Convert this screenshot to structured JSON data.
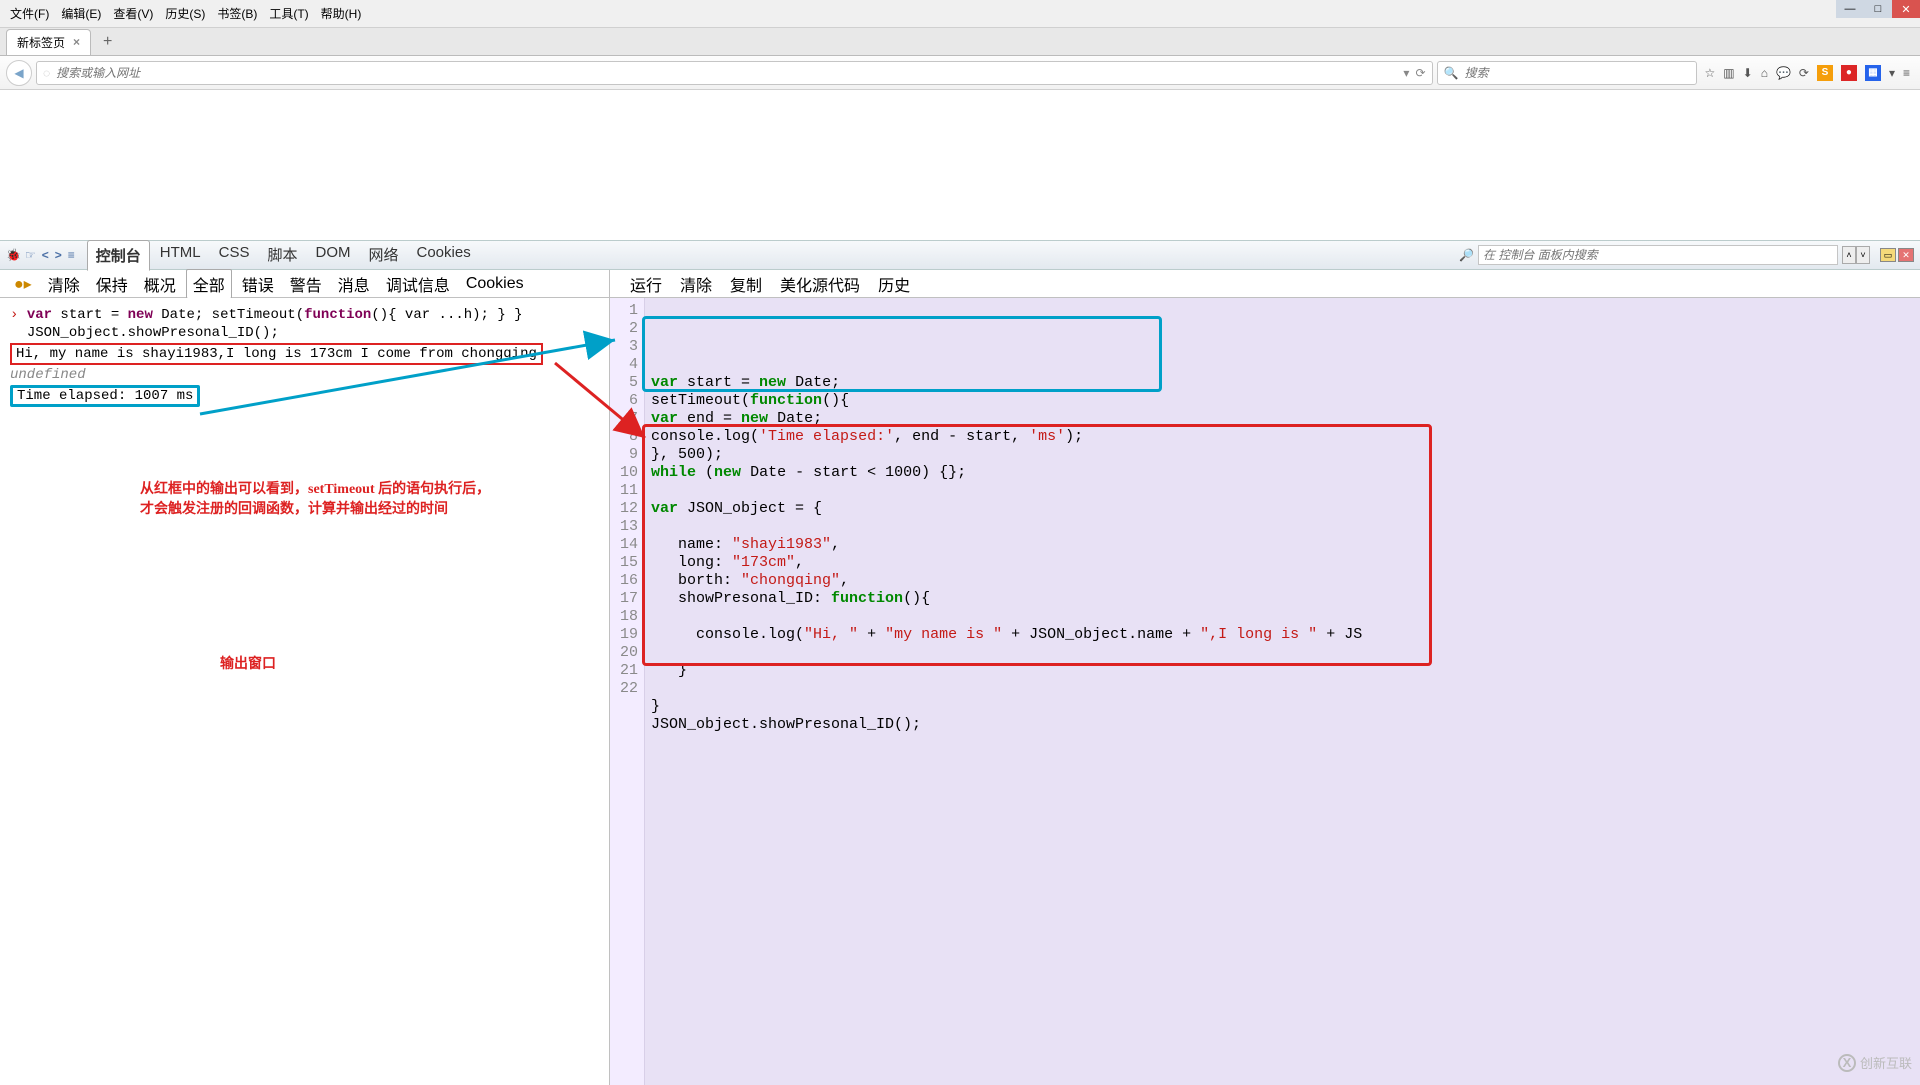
{
  "menu": {
    "items": [
      "文件(F)",
      "编辑(E)",
      "查看(V)",
      "历史(S)",
      "书签(B)",
      "工具(T)",
      "帮助(H)"
    ]
  },
  "tab": {
    "title": "新标签页"
  },
  "url": {
    "placeholder": "搜索或输入网址"
  },
  "search": {
    "placeholder": "搜索"
  },
  "firebug": {
    "tabs": [
      "控制台",
      "HTML",
      "CSS",
      "脚本",
      "DOM",
      "网络",
      "Cookies"
    ],
    "active_tab": "控制台",
    "search_placeholder": "在 控制台 面板内搜索",
    "left_sub": [
      "清除",
      "保持",
      "概况",
      "全部",
      "错误",
      "警告",
      "消息",
      "调试信息",
      "Cookies"
    ],
    "left_sub_pill": "全部",
    "right_sub": [
      "运行",
      "清除",
      "复制",
      "美化源代码",
      "历史"
    ]
  },
  "console": {
    "line1_a": "var",
    "line1_b": " start = ",
    "line1_c": "new",
    "line1_d": " Date; setTimeout(",
    "line1_e": "function",
    "line1_f": "(){ var ...h);      }     }",
    "line2": "JSON_object.showPresonal_ID();",
    "line3": "Hi, my name is shayi1983,I long is 173cm I come from chongqing",
    "line4": "undefined",
    "line5": "Time elapsed: 1007 ms"
  },
  "code": {
    "lines": [
      {
        "n": 1,
        "t": [
          {
            "c": "kw",
            "v": "var"
          },
          {
            "c": "",
            "v": " start = "
          },
          {
            "c": "kw",
            "v": "new"
          },
          {
            "c": "",
            "v": " Date;"
          }
        ]
      },
      {
        "n": 2,
        "t": [
          {
            "c": "",
            "v": "setTimeout("
          },
          {
            "c": "kw",
            "v": "function"
          },
          {
            "c": "",
            "v": "(){"
          }
        ]
      },
      {
        "n": 3,
        "t": [
          {
            "c": "kw",
            "v": "var"
          },
          {
            "c": "",
            "v": " end = "
          },
          {
            "c": "kw",
            "v": "new"
          },
          {
            "c": "",
            "v": " Date;"
          }
        ]
      },
      {
        "n": 4,
        "t": [
          {
            "c": "",
            "v": "console.log("
          },
          {
            "c": "str",
            "v": "'Time elapsed:'"
          },
          {
            "c": "",
            "v": ", end - start, "
          },
          {
            "c": "str",
            "v": "'ms'"
          },
          {
            "c": "",
            "v": ");"
          }
        ]
      },
      {
        "n": 5,
        "t": [
          {
            "c": "",
            "v": "}, 500);"
          }
        ]
      },
      {
        "n": 6,
        "t": [
          {
            "c": "kw",
            "v": "while"
          },
          {
            "c": "",
            "v": " ("
          },
          {
            "c": "kw",
            "v": "new"
          },
          {
            "c": "",
            "v": " Date - start < 1000) {};"
          }
        ]
      },
      {
        "n": 7,
        "t": [
          {
            "c": "",
            "v": ""
          }
        ]
      },
      {
        "n": 8,
        "t": [
          {
            "c": "kw",
            "v": "var"
          },
          {
            "c": "",
            "v": " JSON_object = {"
          }
        ]
      },
      {
        "n": 9,
        "t": [
          {
            "c": "",
            "v": ""
          }
        ]
      },
      {
        "n": 10,
        "t": [
          {
            "c": "",
            "v": "   name: "
          },
          {
            "c": "str",
            "v": "\"shayi1983\""
          },
          {
            "c": "",
            "v": ","
          }
        ]
      },
      {
        "n": 11,
        "t": [
          {
            "c": "",
            "v": "   long: "
          },
          {
            "c": "str",
            "v": "\"173cm\""
          },
          {
            "c": "",
            "v": ","
          }
        ]
      },
      {
        "n": 12,
        "t": [
          {
            "c": "",
            "v": "   borth: "
          },
          {
            "c": "str",
            "v": "\"chongqing\""
          },
          {
            "c": "",
            "v": ","
          }
        ]
      },
      {
        "n": 13,
        "t": [
          {
            "c": "",
            "v": "   showPresonal_ID: "
          },
          {
            "c": "kw",
            "v": "function"
          },
          {
            "c": "",
            "v": "(){"
          }
        ]
      },
      {
        "n": 14,
        "t": [
          {
            "c": "",
            "v": ""
          }
        ]
      },
      {
        "n": 15,
        "t": [
          {
            "c": "",
            "v": "     console.log("
          },
          {
            "c": "str",
            "v": "\"Hi, \""
          },
          {
            "c": "",
            "v": " + "
          },
          {
            "c": "str",
            "v": "\"my name is \""
          },
          {
            "c": "",
            "v": " + JSON_object.name + "
          },
          {
            "c": "str",
            "v": "\",I long is \""
          },
          {
            "c": "",
            "v": " + JS"
          }
        ]
      },
      {
        "n": 16,
        "t": [
          {
            "c": "",
            "v": ""
          }
        ]
      },
      {
        "n": 17,
        "t": [
          {
            "c": "",
            "v": "   }"
          }
        ]
      },
      {
        "n": 18,
        "t": [
          {
            "c": "",
            "v": ""
          }
        ]
      },
      {
        "n": 19,
        "t": [
          {
            "c": "",
            "v": "}"
          }
        ]
      },
      {
        "n": 20,
        "t": [
          {
            "c": "",
            "v": "JSON_object.showPresonal_ID();"
          }
        ]
      },
      {
        "n": 21,
        "t": [
          {
            "c": "",
            "v": ""
          }
        ]
      },
      {
        "n": 22,
        "t": [
          {
            "c": "",
            "v": ""
          }
        ]
      }
    ]
  },
  "annotations": {
    "note1_l1": "从红框中的输出可以看到，setTimeout 后的语句执行后，",
    "note1_l2": "才会触发注册的回调函数，计算并输出经过的时间",
    "note2": "输出窗口"
  },
  "watermark": "创新互联"
}
